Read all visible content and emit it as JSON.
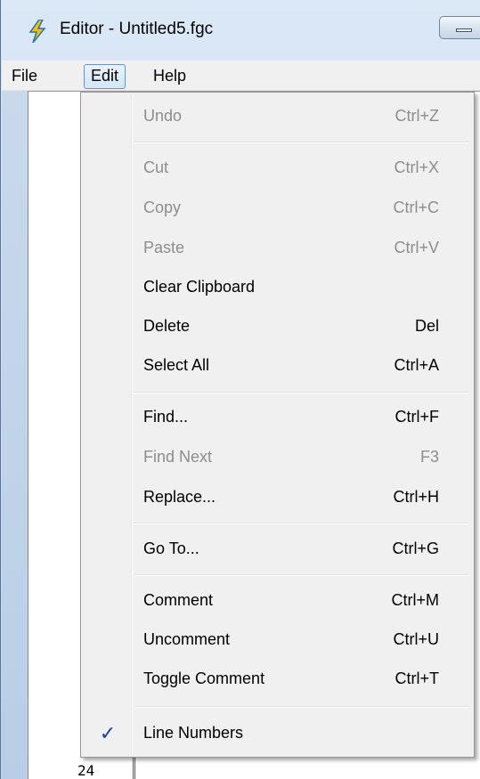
{
  "window": {
    "title": "Editor - Untitled5.fgc"
  },
  "menubar": {
    "file": "File",
    "edit": "Edit",
    "help": "Help"
  },
  "edit_menu": {
    "items": [
      {
        "label": "Undo",
        "shortcut": "Ctrl+Z",
        "enabled": false
      },
      {
        "label": "Cut",
        "shortcut": "Ctrl+X",
        "enabled": false
      },
      {
        "label": "Copy",
        "shortcut": "Ctrl+C",
        "enabled": false
      },
      {
        "label": "Paste",
        "shortcut": "Ctrl+V",
        "enabled": false
      },
      {
        "label": "Clear Clipboard",
        "shortcut": "",
        "enabled": true
      },
      {
        "label": "Delete",
        "shortcut": "Del",
        "enabled": true
      },
      {
        "label": "Select All",
        "shortcut": "Ctrl+A",
        "enabled": true
      },
      {
        "label": "Find...",
        "shortcut": "Ctrl+F",
        "enabled": true
      },
      {
        "label": "Find Next",
        "shortcut": "F3",
        "enabled": false
      },
      {
        "label": "Replace...",
        "shortcut": "Ctrl+H",
        "enabled": true
      },
      {
        "label": "Go To...",
        "shortcut": "Ctrl+G",
        "enabled": true
      },
      {
        "label": "Comment",
        "shortcut": "Ctrl+M",
        "enabled": true
      },
      {
        "label": "Uncomment",
        "shortcut": "Ctrl+U",
        "enabled": true
      },
      {
        "label": "Toggle Comment",
        "shortcut": "Ctrl+T",
        "enabled": true
      },
      {
        "label": "Line Numbers",
        "shortcut": "",
        "enabled": true,
        "checked": true
      }
    ],
    "check_glyph": "✓"
  },
  "editor": {
    "visible_line_number": "24"
  },
  "colors": {
    "check": "#1c3fa0",
    "disabled_text": "#8d8d8d",
    "menu_bg": "#f0f0f0"
  }
}
